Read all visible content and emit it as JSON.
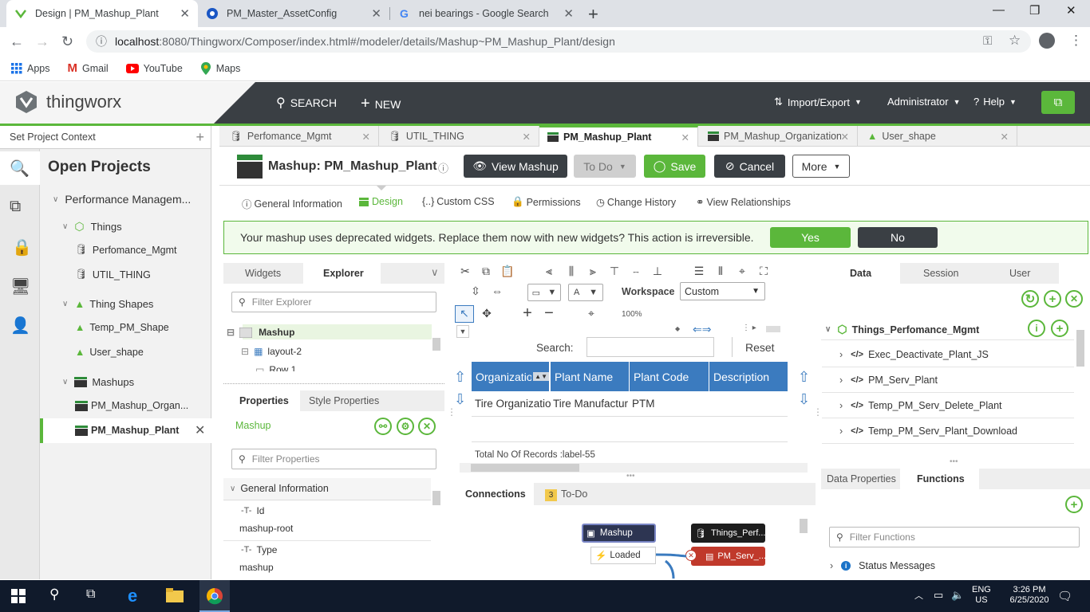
{
  "browser": {
    "tabs": [
      {
        "title": "Design | PM_Mashup_Plant",
        "icon": "thingworx-icon",
        "active": true
      },
      {
        "title": "PM_Master_AssetConfig",
        "icon": "chrome-settings-icon",
        "active": false
      },
      {
        "title": "nei bearings - Google Search",
        "icon": "google-icon",
        "active": false
      }
    ],
    "url_host": "localhost",
    "url_rest": ":8080/Thingworx/Composer/index.html#/modeler/details/Mashup~PM_Mashup_Plant/design",
    "bookmarks": [
      "Apps",
      "Gmail",
      "YouTube",
      "Maps"
    ]
  },
  "app": {
    "logo": "thingworx",
    "search": "SEARCH",
    "new": "NEW",
    "import_export": "Import/Export",
    "user": "Administrator",
    "help": "Help"
  },
  "left": {
    "project_context": "Set Project Context",
    "title": "Open Projects",
    "tree": {
      "root": "Performance Managem...",
      "things": "Things",
      "thing1": "Perfomance_Mgmt",
      "thing2": "UTIL_THING",
      "shapes": "Thing Shapes",
      "shape1": "Temp_PM_Shape",
      "shape2": "User_shape",
      "mashups": "Mashups",
      "mashup1": "PM_Mashup_Organ...",
      "mashup2": "PM_Mashup_Plant"
    }
  },
  "editor_tabs": [
    "Perfomance_Mgmt",
    "UTIL_THING",
    "PM_Mashup_Plant",
    "PM_Mashup_Organization",
    "User_shape"
  ],
  "entity": {
    "title": "Mashup: PM_Mashup_Plant",
    "view_mashup": "View Mashup",
    "todo": "To Do",
    "save": "Save",
    "cancel": "Cancel",
    "more": "More"
  },
  "subtabs": [
    "General Information",
    "Design",
    "Custom CSS",
    "Permissions",
    "Change History",
    "View Relationships"
  ],
  "banner": {
    "message": "Your mashup uses deprecated widgets. Replace them now with new widgets? This action is irreversible.",
    "yes": "Yes",
    "no": "No"
  },
  "explorer": {
    "tab_widgets": "Widgets",
    "tab_explorer": "Explorer",
    "filter_placeholder": "Filter Explorer",
    "items": [
      "Mashup",
      "layout-2",
      "Row 1"
    ]
  },
  "properties": {
    "tab_props": "Properties",
    "tab_style": "Style Properties",
    "selected": "Mashup",
    "filter_placeholder": "Filter Properties",
    "section": "General Information",
    "id_label": "Id",
    "id_value": "mashup-root",
    "type_label": "Type",
    "type_value": "mashup"
  },
  "canvas": {
    "workspace_label": "Workspace",
    "workspace_value": "Custom",
    "zoom": "100%",
    "search_label": "Search:",
    "reset": "Reset",
    "columns": [
      "Organizatio",
      "Plant Name",
      "Plant Code",
      "Description"
    ],
    "row": [
      "Tire Organizatio",
      "Tire Manufactur",
      "PTM",
      ""
    ],
    "footer": "Total No Of Records :label-55"
  },
  "connections": {
    "tab_connections": "Connections",
    "todo_count": "3",
    "tab_todo": "To-Do",
    "nodes": {
      "mashup": "Mashup",
      "loaded": "Loaded",
      "things": "Things_Perf...",
      "service": "PM_Serv_..."
    }
  },
  "data_panel": {
    "tabs": [
      "Data",
      "Session",
      "User"
    ],
    "entity": "Things_Perfomance_Mgmt",
    "services": [
      "Exec_Deactivate_Plant_JS",
      "PM_Serv_Plant",
      "Temp_PM_Serv_Delete_Plant",
      "Temp_PM_Serv_Plant_Download"
    ]
  },
  "bottom_right": {
    "tab_data_props": "Data Properties",
    "tab_functions": "Functions",
    "filter_placeholder": "Filter Functions",
    "status_messages": "Status Messages"
  },
  "taskbar": {
    "lang1": "ENG",
    "lang2": "US",
    "time": "3:26 PM",
    "date": "6/25/2020"
  },
  "colors": {
    "accent_green": "#5bb73b",
    "header_dark": "#3a3f44",
    "grid_blue": "#3b7bbf",
    "service_red": "#c0392b"
  }
}
